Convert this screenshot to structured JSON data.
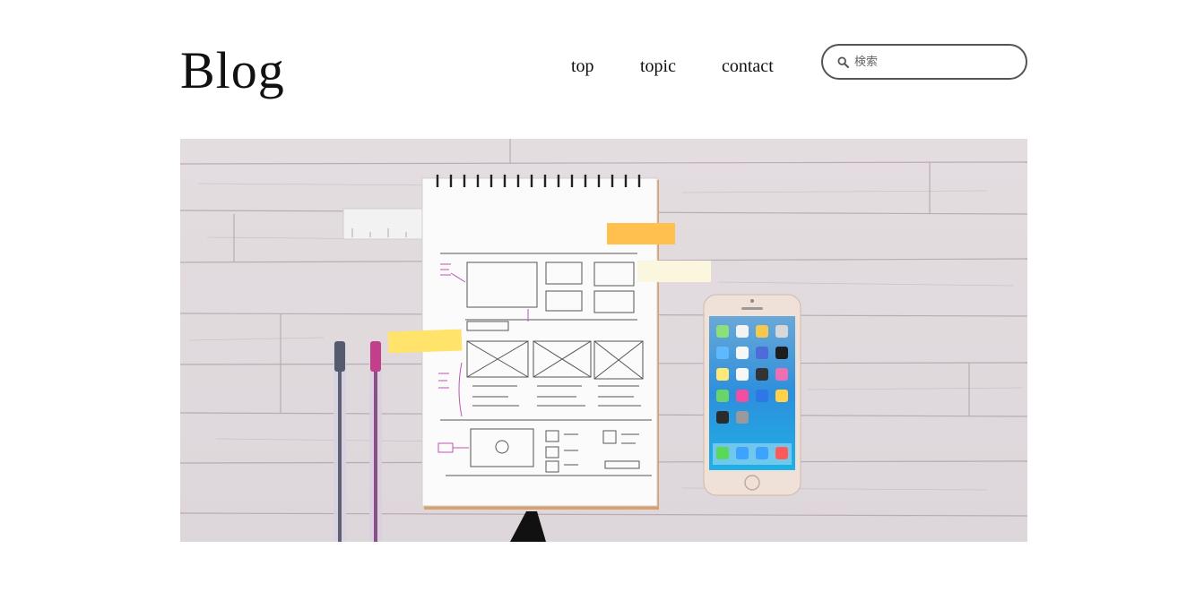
{
  "header": {
    "logo": "Blog",
    "nav": [
      {
        "label": "top"
      },
      {
        "label": "topic"
      },
      {
        "label": "contact"
      }
    ],
    "search": {
      "placeholder": "検索",
      "icon": "search-icon"
    }
  },
  "hero": {
    "description": "Wooden desk with a wireframe sketch notebook, ruler, pens, sticky notes and a smartphone"
  }
}
